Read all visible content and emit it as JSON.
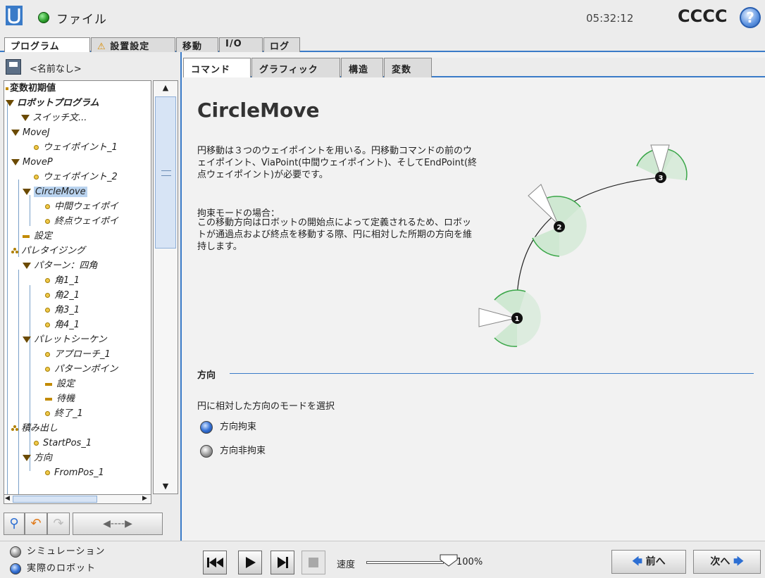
{
  "header": {
    "title": "ファイル",
    "clock": "05:32:12",
    "robot_name": "CCCC",
    "help_icon": "?"
  },
  "top_tabs": [
    "プログラム",
    "設置設定",
    "移動",
    "I/O",
    "ログ"
  ],
  "program": {
    "name": "<名前なし>"
  },
  "tree": {
    "items": [
      "変数初期値",
      "ロボットプログラム",
      "スイッチ文...",
      "MoveJ",
      "ウェイポイント_1",
      "MoveP",
      "ウェイポイント_2",
      "CircleMove",
      "中間ウェイポイ",
      "終点ウェイポイ",
      "設定",
      "パレタイジング",
      "パターン：四角",
      "角1_1",
      "角2_1",
      "角3_1",
      "角4_1",
      "パレットシーケン",
      "アプローチ_1",
      "パターンポイン",
      "設定",
      "待機",
      "終了_1",
      "積み出し",
      "StartPos_1",
      "方向",
      "FromPos_1"
    ]
  },
  "sub_tabs": [
    "コマンド",
    "グラフィック",
    "構造",
    "変数"
  ],
  "content": {
    "heading": "CircleMove",
    "description": "円移動は３つのウェイポイントを用いる。円移動コマンドの前のウェイポイント、ViaPoint(中間ウェイポイント)、そしてEndPoint(終点ウェイポイント)が必要です。",
    "constraint_title": "拘束モードの場合：",
    "constraint_text": "この移動方向はロボットの開始点によって定義されるため、ロボットが通過点および終点を移動する際、円に相対した所期の方向を維持します。",
    "diagram_points": [
      "1",
      "2",
      "3"
    ],
    "orientation_section": "方向",
    "orientation_prompt": "円に相対した方向のモードを選択",
    "radio_constrained": "方向拘束",
    "radio_unconstrained": "方向非拘束",
    "selected_mode": "方向拘束"
  },
  "footer": {
    "simulation": "シミュレーション",
    "real_robot": "実際のロボット",
    "active_mode": "実際のロボット",
    "speed_label": "速度",
    "speed_value": "100%",
    "speed_fraction": 1.0,
    "prev": "前へ",
    "next": "次へ"
  },
  "colors": {
    "accent": "#3a7bc8",
    "status_green": "#2ea02e",
    "warning": "#d88b00",
    "zone_fill": "#cfe8d2",
    "zone_stroke": "#3aa648"
  }
}
